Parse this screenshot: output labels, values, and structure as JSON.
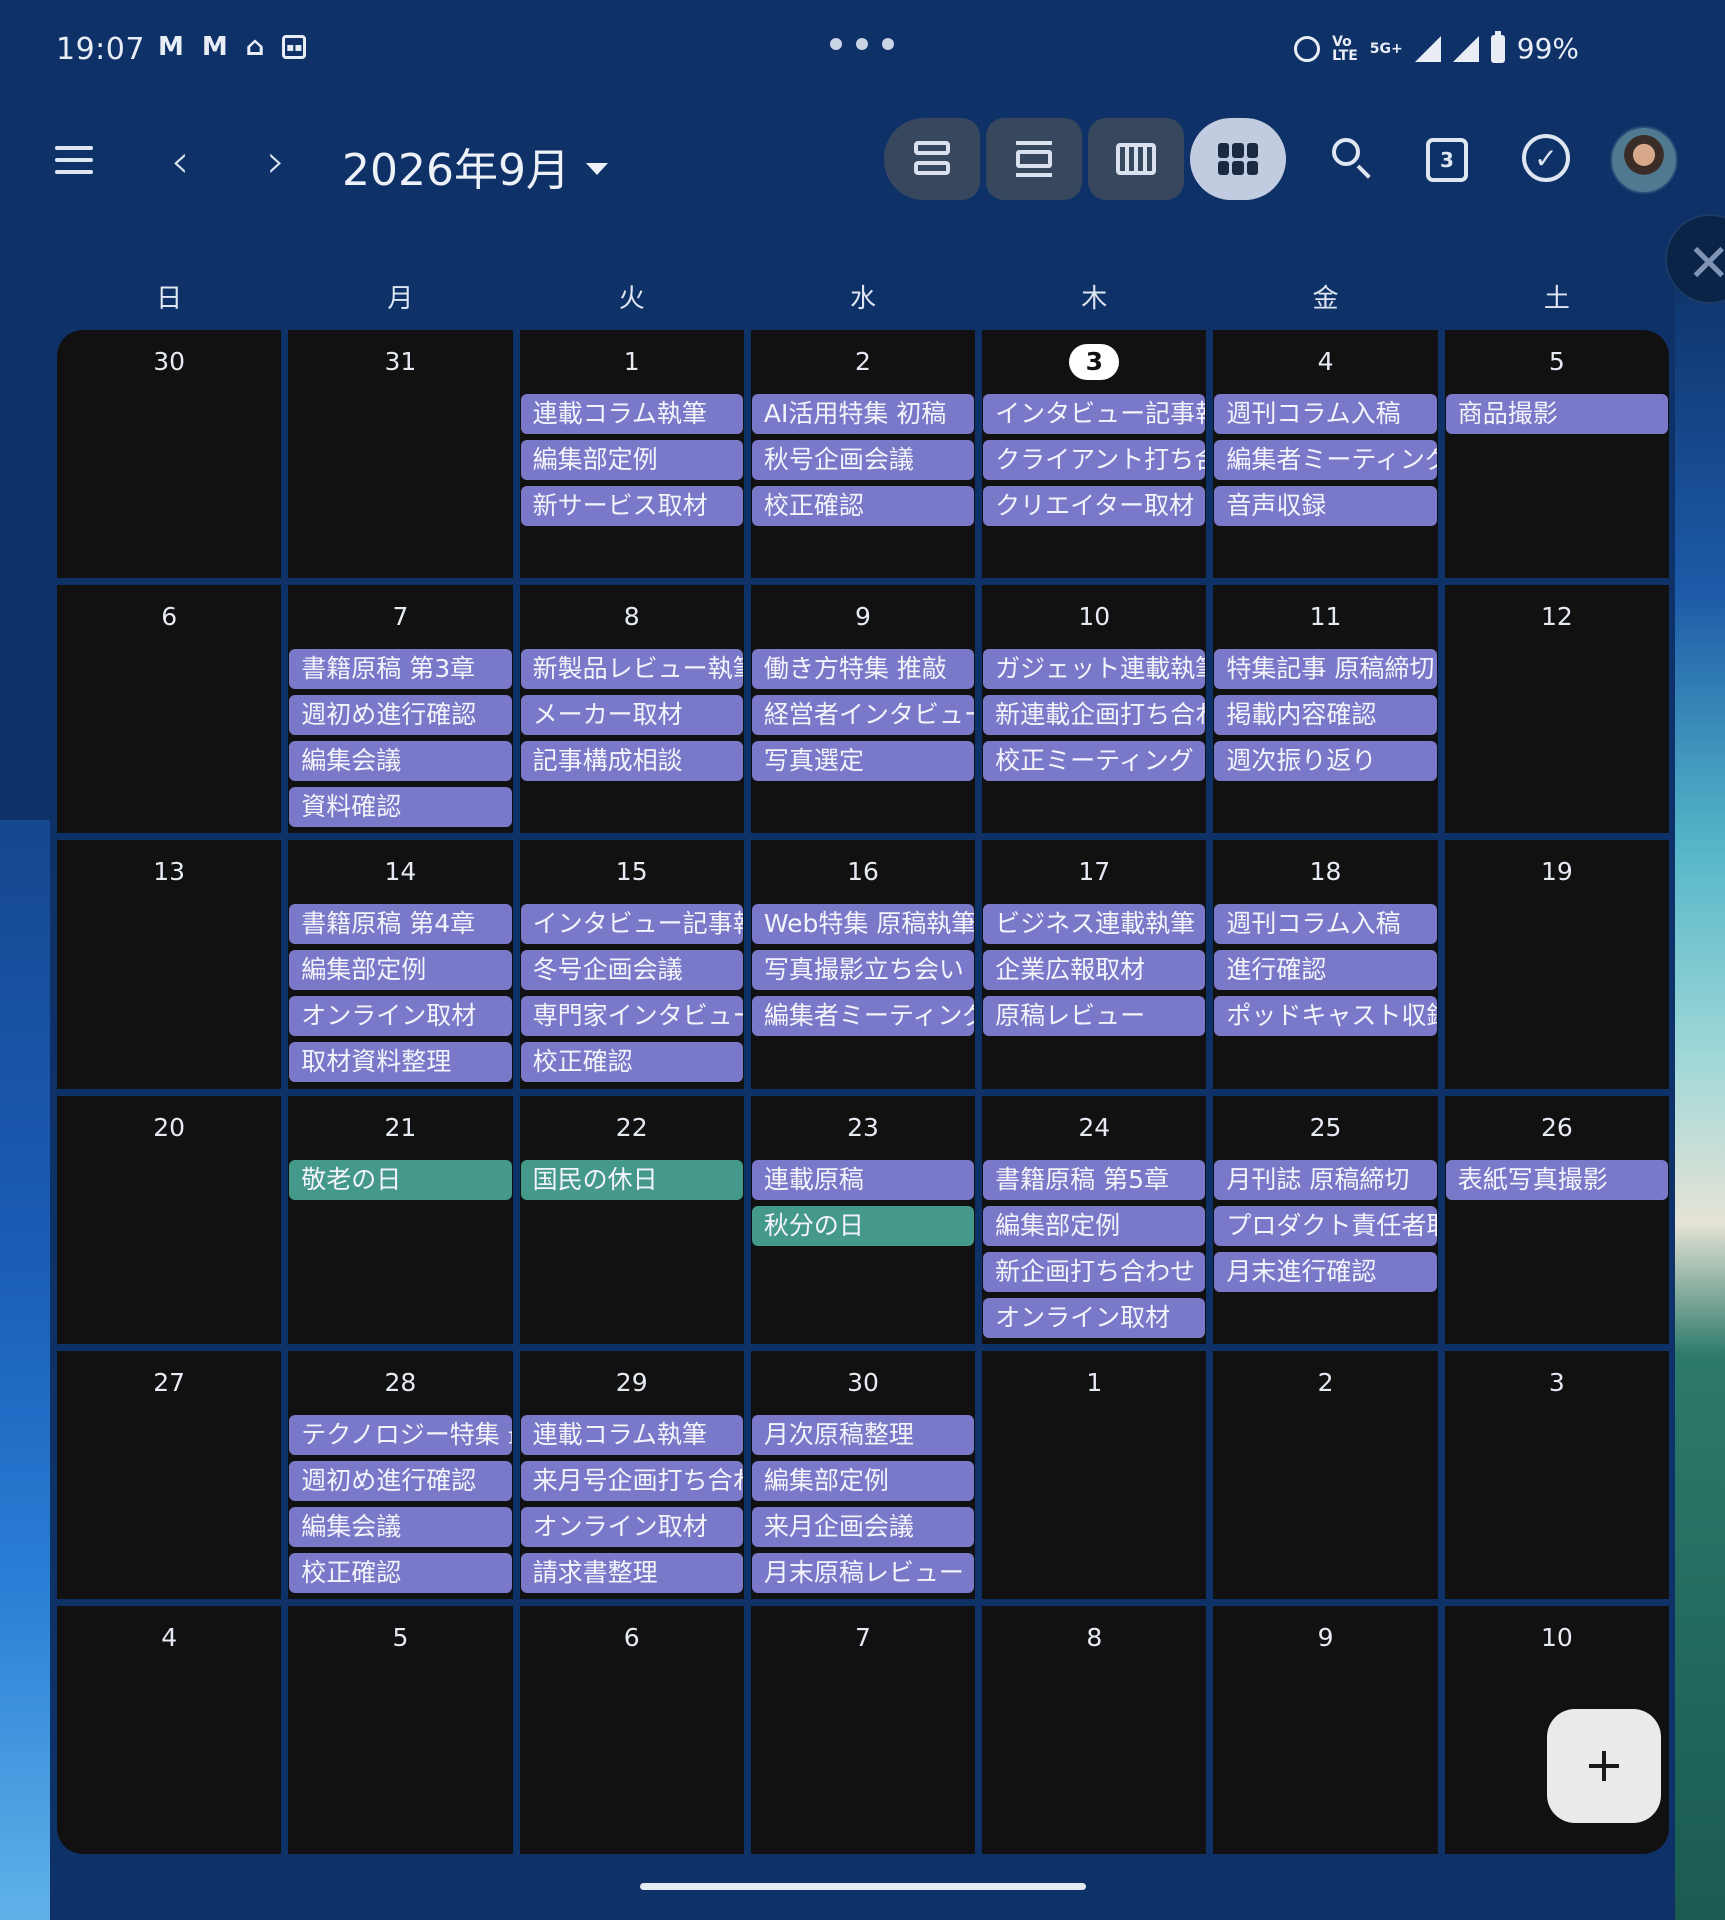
{
  "status": {
    "time": "19:07",
    "battery": "99%",
    "network": "5G+",
    "volte_top": "Vo",
    "volte_bottom": "LTE"
  },
  "header": {
    "month_title": "2026年9月",
    "today_badge": "3"
  },
  "weekdays": [
    "日",
    "月",
    "火",
    "水",
    "木",
    "金",
    "土"
  ],
  "days": [
    {
      "num": "30",
      "events": []
    },
    {
      "num": "31",
      "events": []
    },
    {
      "num": "1",
      "events": [
        {
          "t": "連載コラム執筆"
        },
        {
          "t": "編集部定例"
        },
        {
          "t": "新サービス取材"
        }
      ]
    },
    {
      "num": "2",
      "events": [
        {
          "t": "AI活用特集 初稿"
        },
        {
          "t": "秋号企画会議"
        },
        {
          "t": "校正確認"
        }
      ]
    },
    {
      "num": "3",
      "today": true,
      "events": [
        {
          "t": "インタビュー記事執筆"
        },
        {
          "t": "クライアント打ち合わせ"
        },
        {
          "t": "クリエイター取材"
        }
      ]
    },
    {
      "num": "4",
      "events": [
        {
          "t": "週刊コラム入稿"
        },
        {
          "t": "編集者ミーティング"
        },
        {
          "t": "音声収録"
        }
      ]
    },
    {
      "num": "5",
      "events": [
        {
          "t": "商品撮影"
        }
      ]
    },
    {
      "num": "6",
      "events": []
    },
    {
      "num": "7",
      "events": [
        {
          "t": "書籍原稿 第3章"
        },
        {
          "t": "週初め進行確認"
        },
        {
          "t": "編集会議"
        },
        {
          "t": "資料確認"
        }
      ]
    },
    {
      "num": "8",
      "events": [
        {
          "t": "新製品レビュー執筆"
        },
        {
          "t": "メーカー取材"
        },
        {
          "t": "記事構成相談"
        }
      ]
    },
    {
      "num": "9",
      "events": [
        {
          "t": "働き方特集 推敲"
        },
        {
          "t": "経営者インタビュー"
        },
        {
          "t": "写真選定"
        }
      ]
    },
    {
      "num": "10",
      "events": [
        {
          "t": "ガジェット連載執筆"
        },
        {
          "t": "新連載企画打ち合わせ"
        },
        {
          "t": "校正ミーティング"
        }
      ]
    },
    {
      "num": "11",
      "events": [
        {
          "t": "特集記事 原稿締切"
        },
        {
          "t": "掲載内容確認"
        },
        {
          "t": "週次振り返り"
        }
      ]
    },
    {
      "num": "12",
      "events": []
    },
    {
      "num": "13",
      "events": []
    },
    {
      "num": "14",
      "events": [
        {
          "t": "書籍原稿 第4章"
        },
        {
          "t": "編集部定例"
        },
        {
          "t": "オンライン取材"
        },
        {
          "t": "取材資料整理"
        }
      ]
    },
    {
      "num": "15",
      "events": [
        {
          "t": "インタビュー記事執筆"
        },
        {
          "t": "冬号企画会議"
        },
        {
          "t": "専門家インタビュー"
        },
        {
          "t": "校正確認"
        }
      ]
    },
    {
      "num": "16",
      "events": [
        {
          "t": "Web特集 原稿執筆"
        },
        {
          "t": "写真撮影立ち会い"
        },
        {
          "t": "編集者ミーティング"
        }
      ]
    },
    {
      "num": "17",
      "events": [
        {
          "t": "ビジネス連載執筆"
        },
        {
          "t": "企業広報取材"
        },
        {
          "t": "原稿レビュー"
        }
      ]
    },
    {
      "num": "18",
      "events": [
        {
          "t": "週刊コラム入稿"
        },
        {
          "t": "進行確認"
        },
        {
          "t": "ポッドキャスト収録"
        }
      ]
    },
    {
      "num": "19",
      "events": []
    },
    {
      "num": "20",
      "events": []
    },
    {
      "num": "21",
      "events": [
        {
          "t": "敬老の日",
          "holiday": true
        }
      ]
    },
    {
      "num": "22",
      "events": [
        {
          "t": "国民の休日",
          "holiday": true
        }
      ]
    },
    {
      "num": "23",
      "events": [
        {
          "t": "連載原稿"
        },
        {
          "t": "秋分の日",
          "holiday": true
        }
      ]
    },
    {
      "num": "24",
      "events": [
        {
          "t": "書籍原稿 第5章"
        },
        {
          "t": "編集部定例"
        },
        {
          "t": "新企画打ち合わせ"
        },
        {
          "t": "オンライン取材"
        }
      ]
    },
    {
      "num": "25",
      "events": [
        {
          "t": "月刊誌 原稿締切"
        },
        {
          "t": "プロダクト責任者取材"
        },
        {
          "t": "月末進行確認"
        }
      ]
    },
    {
      "num": "26",
      "events": [
        {
          "t": "表紙写真撮影"
        }
      ]
    },
    {
      "num": "27",
      "events": []
    },
    {
      "num": "28",
      "events": [
        {
          "t": "テクノロジー特集 最終稿"
        },
        {
          "t": "週初め進行確認"
        },
        {
          "t": "編集会議"
        },
        {
          "t": "校正確認"
        }
      ]
    },
    {
      "num": "29",
      "events": [
        {
          "t": "連載コラム執筆"
        },
        {
          "t": "来月号企画打ち合わせ"
        },
        {
          "t": "オンライン取材"
        },
        {
          "t": "請求書整理"
        }
      ]
    },
    {
      "num": "30",
      "events": [
        {
          "t": "月次原稿整理"
        },
        {
          "t": "編集部定例"
        },
        {
          "t": "来月企画会議"
        },
        {
          "t": "月末原稿レビュー"
        }
      ]
    },
    {
      "num": "1",
      "events": []
    },
    {
      "num": "2",
      "events": []
    },
    {
      "num": "3",
      "events": []
    },
    {
      "num": "4",
      "events": []
    },
    {
      "num": "5",
      "events": []
    },
    {
      "num": "6",
      "events": []
    },
    {
      "num": "7",
      "events": []
    },
    {
      "num": "8",
      "events": []
    },
    {
      "num": "9",
      "events": []
    },
    {
      "num": "10",
      "events": []
    }
  ],
  "colors": {
    "event": "#7a78c9",
    "holiday": "#44998a",
    "cell": "#111111",
    "background": "#0e3268"
  }
}
